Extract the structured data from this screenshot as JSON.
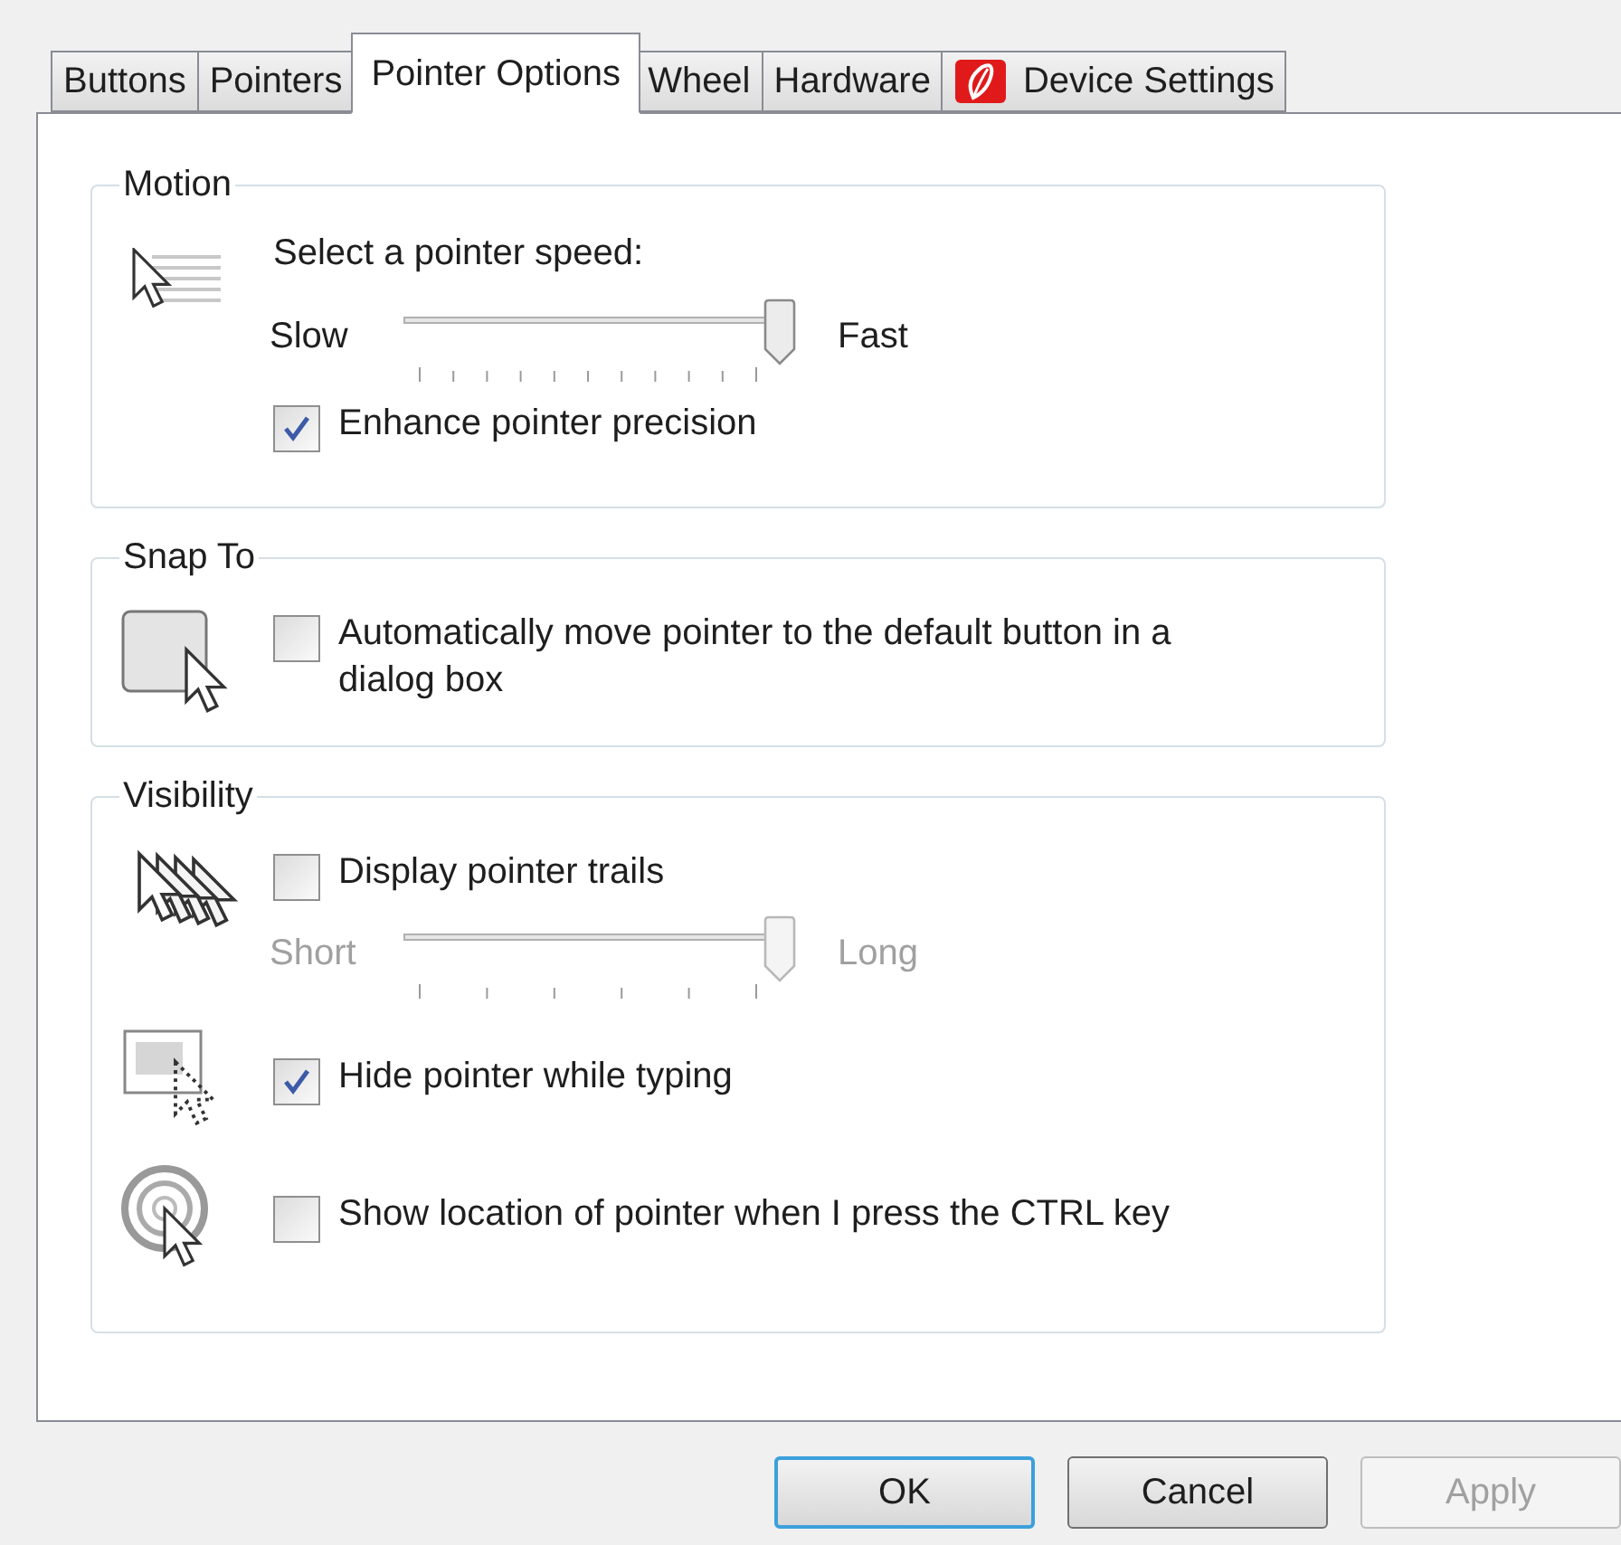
{
  "tabs": [
    {
      "label": "Buttons",
      "selected": false
    },
    {
      "label": "Pointers",
      "selected": false
    },
    {
      "label": "Pointer Options",
      "selected": true
    },
    {
      "label": "Wheel",
      "selected": false
    },
    {
      "label": "Hardware",
      "selected": false
    },
    {
      "label": "Device Settings",
      "selected": false,
      "kind": "icon"
    }
  ],
  "motion": {
    "title": "Motion",
    "prompt": "Select a pointer speed:",
    "slider": {
      "min_label": "Slow",
      "max_label": "Fast",
      "level": 1,
      "disabled": false
    },
    "checkbox": {
      "label": "Enhance pointer precision",
      "checked": true
    }
  },
  "snap_to": {
    "title": "Snap To",
    "checkbox": {
      "label": "Automatically move pointer to the default button in a dialog box",
      "checked": false
    }
  },
  "visibility": {
    "title": "Visibility",
    "trails": {
      "label": "Display pointer trails",
      "checked": false
    },
    "trail_slider": {
      "min_label": "Short",
      "max_label": "Long",
      "level": 1,
      "disabled": true
    },
    "hide": {
      "label": "Hide pointer while typing",
      "checked": true
    },
    "locate": {
      "label": "Show location of pointer when I press the CTRL key",
      "checked": false
    }
  },
  "buttons": [
    {
      "label": "OK",
      "kind": "default",
      "disabled": false
    },
    {
      "label": "Cancel",
      "kind": "normal",
      "disabled": false
    },
    {
      "label": "Apply",
      "kind": "normal",
      "disabled": true
    }
  ]
}
